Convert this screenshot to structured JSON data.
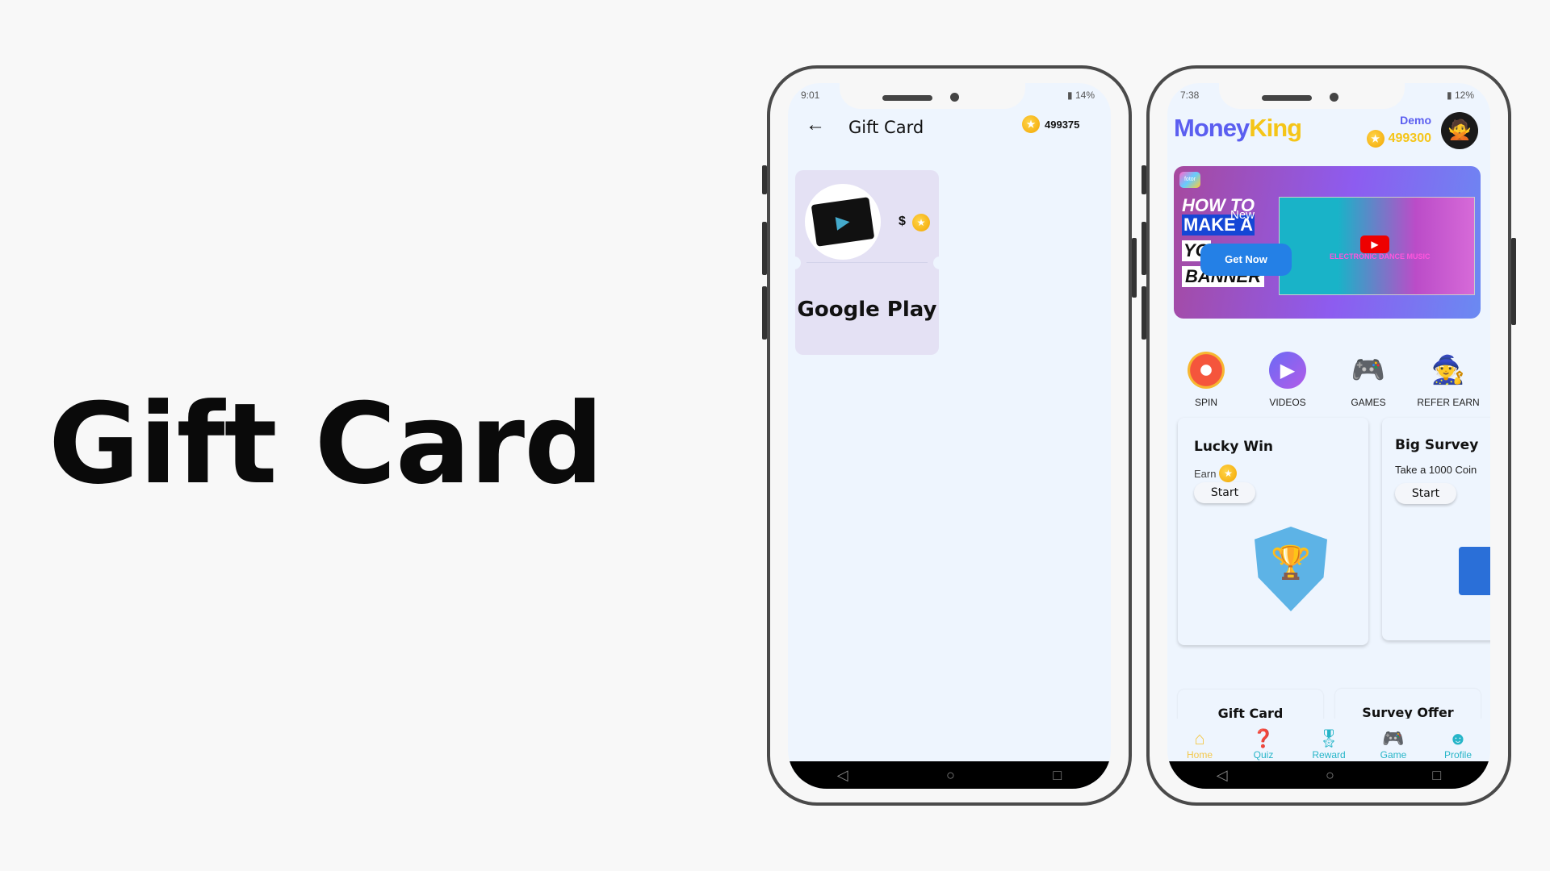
{
  "hero_title": "Gift Card",
  "phone1": {
    "status": {
      "time": "9:01",
      "battery": "14%"
    },
    "header": {
      "title": "Gift Card",
      "coins": "499375"
    },
    "card": {
      "name": "Google Play",
      "price_symbol": "$"
    }
  },
  "phone2": {
    "status": {
      "time": "7:38",
      "battery": "12%"
    },
    "brand": {
      "part1": "Money",
      "part2": "King"
    },
    "user": {
      "name": "Demo",
      "coins": "499300"
    },
    "banner": {
      "logo": "fotor",
      "line1": "HOW TO",
      "line1b": "New",
      "line2": "MAKE A",
      "line3": "YO",
      "line4": "BANNER",
      "cta": "Get Now",
      "video_text": "ELECTRONIC DANCE MUSIC"
    },
    "features": [
      {
        "label": "SPIN",
        "icon": "spin-wheel-icon"
      },
      {
        "label": "VIDEOS",
        "icon": "play-icon"
      },
      {
        "label": "GAMES",
        "icon": "gamepad-icon"
      },
      {
        "label": "REFER EARN",
        "icon": "wizard-icon"
      }
    ],
    "cards": [
      {
        "title": "Lucky Win",
        "subtitle": "Earn",
        "button": "Start"
      },
      {
        "title": "Big Survey",
        "subtitle": "Take a 1000 Coin",
        "button": "Start"
      }
    ],
    "bottom_cards": [
      "Gift Card",
      "Survey Offer"
    ],
    "bottom_nav": [
      {
        "label": "Home",
        "icon": "home-icon"
      },
      {
        "label": "Quiz",
        "icon": "question-icon"
      },
      {
        "label": "Reward",
        "icon": "medal-icon"
      },
      {
        "label": "Game",
        "icon": "gamepad-icon"
      },
      {
        "label": "Profile",
        "icon": "profile-icon"
      }
    ]
  },
  "colors": {
    "brand_blue": "#5b5ef0",
    "brand_yellow": "#f5c518",
    "teal": "#26b5c8",
    "card_bg": "#e4e1f4",
    "screen_bg": "#eef5fe"
  }
}
